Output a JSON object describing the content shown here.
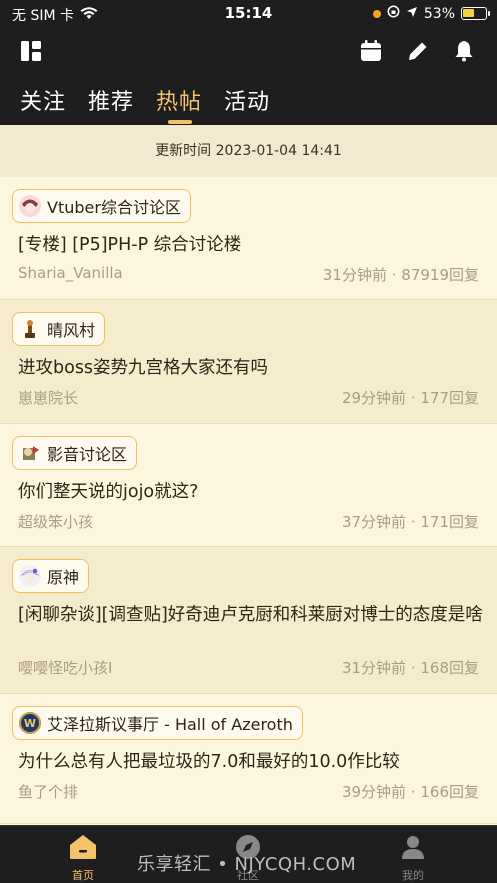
{
  "status_bar": {
    "carrier": "无 SIM 卡",
    "time": "15:14",
    "battery": "53%",
    "battery_level": 0.53
  },
  "toolbar": {
    "icons": [
      "grid-icon",
      "calendar-icon",
      "pencil-icon",
      "bell-icon"
    ]
  },
  "tabs": [
    {
      "label": "关注",
      "active": false
    },
    {
      "label": "推荐",
      "active": false
    },
    {
      "label": "热帖",
      "active": true
    },
    {
      "label": "活动",
      "active": false
    }
  ],
  "update_banner": "更新时间 2023-01-04 14:41",
  "posts": [
    {
      "forum": "Vtuber综合讨论区",
      "title": "[专楼] [P5]PH-P 综合讨论楼",
      "author": "Sharia_Vanilla",
      "stats": "31分钟前 · 87919回复"
    },
    {
      "forum": "晴风村",
      "title": "进攻boss姿势九宫格大家还有吗",
      "author": "崽崽院长",
      "stats": "29分钟前 · 177回复"
    },
    {
      "forum": "影音讨论区",
      "title": "你们整天说的jojo就这?",
      "author": "超级笨小孩",
      "stats": "37分钟前 · 171回复"
    },
    {
      "forum": "原神",
      "title": "[闲聊杂谈][调查贴]好奇迪卢克厨和科莱厨对博士的态度是啥",
      "author": "嘤嘤怪吃小孩I",
      "stats": "31分钟前 · 168回复"
    },
    {
      "forum": "艾泽拉斯议事厅 - Hall of Azeroth",
      "title": "为什么总有人把最垃圾的7.0和最好的10.0作比较",
      "author": "鱼了个排",
      "stats": "39分钟前 · 166回复"
    }
  ],
  "bottom_nav": [
    {
      "label": "首页",
      "icon": "home-icon",
      "active": true
    },
    {
      "label": "社区",
      "icon": "compass-icon",
      "active": false
    },
    {
      "label": "我的",
      "icon": "profile-icon",
      "active": false
    }
  ],
  "watermark": "乐享轻汇 • NJYCQH.COM",
  "colors": {
    "accent": "#f4c26b",
    "header_bg": "#1e1e1e",
    "card_bg": "#fdf6df"
  }
}
